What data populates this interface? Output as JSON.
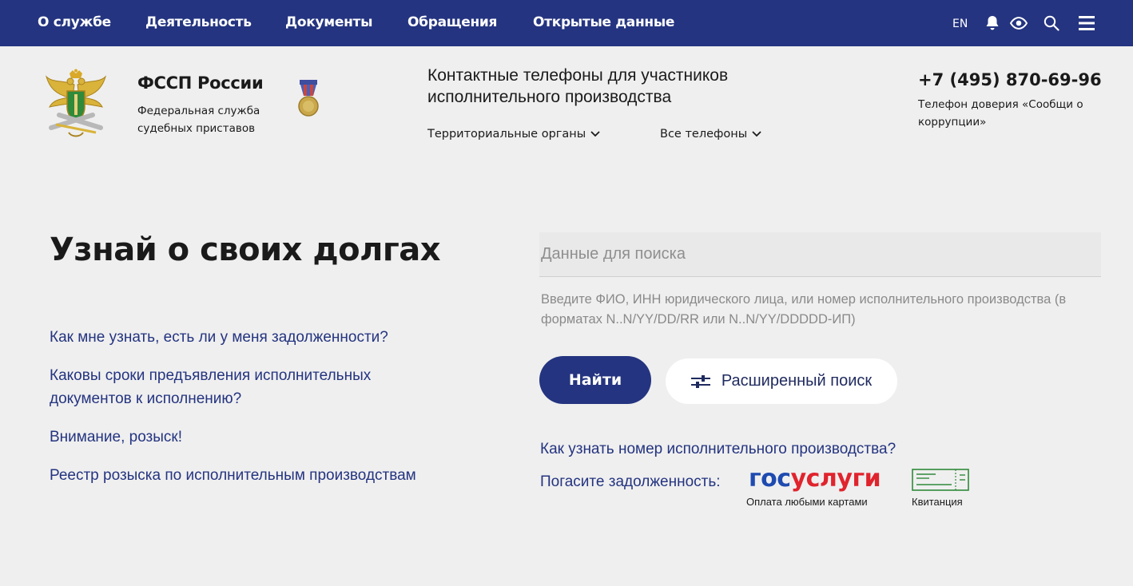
{
  "nav": {
    "items": [
      "О службе",
      "Деятельность",
      "Документы",
      "Обращения",
      "Открытые данные"
    ],
    "lang": "EN",
    "icons": [
      "bell-icon",
      "eye-icon",
      "search-icon",
      "menu-icon"
    ]
  },
  "header": {
    "org_title": "ФССП России",
    "org_subtitle": "Федеральная служба судебных приставов",
    "contacts_title": "Контактные телефоны для участников исполнительного производства",
    "territorial": "Территориальные органы",
    "all_phones": "Все телефоны",
    "phone": "+7 (495) 870-69-96",
    "phone_subtitle": "Телефон доверия «Сообщи о коррупции»"
  },
  "main": {
    "heading": "Узнай о своих долгах",
    "faq": [
      "Как мне узнать, есть ли у меня задолженности?",
      "Каковы сроки предъявления исполнительных документов к исполнению?",
      "Внимание, розыск!",
      "Реестр розыска по исполнительным производствам"
    ],
    "search_placeholder": "Данные для поиска",
    "search_hint": "Введите ФИО, ИНН юридического лица, или номер исполнительного производства (в форматах N..N/YY/DD/RR или N..N/YY/DDDDD-ИП)",
    "find_button": "Найти",
    "advanced_button": "Расширенный поиск",
    "how_link": "Как узнать номер исполнительного производства?",
    "pay_label": "Погасите задолженность:",
    "gos_part1": "гос",
    "gos_part2": "услуги",
    "gos_sub": "Оплата любыми картами",
    "receipt_sub": "Квитанция"
  },
  "colors": {
    "nav_bg": "#243480",
    "accent": "#243480",
    "page_bg": "#efefef",
    "gos_blue": "#1e4bb0",
    "gos_red": "#e0242d"
  }
}
